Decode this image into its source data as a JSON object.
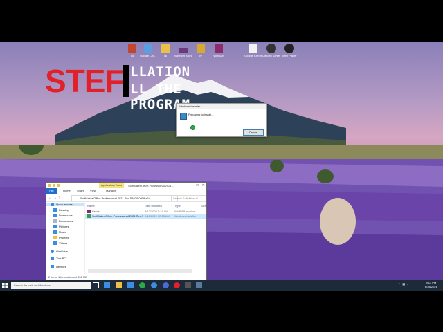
{
  "desktop_icons": [
    {
      "label": "y5",
      "color": "#c2452e"
    },
    {
      "label": "Google Chr...",
      "color": "#5aa0e0"
    },
    {
      "label": "y6",
      "color": "#e9c14a"
    },
    {
      "label": "WinRAR Archive",
      "color": "#6a3a7a"
    },
    {
      "label": "y7",
      "color": "#d9a830"
    },
    {
      "label": "WinRAR",
      "color": "#8c2a6a"
    },
    {
      "label": "Google Chrome",
      "color": "#f2f2f2"
    },
    {
      "label": "Discord Screen...",
      "color": "#333333"
    },
    {
      "label": "Vinyl Player",
      "color": "#222222"
    }
  ],
  "overlay": {
    "red_text": "STEF",
    "line1": "LLATION",
    "line2": "LL THE PROGRAM"
  },
  "installer": {
    "title": "Windows Installer",
    "message": "Preparing to install...",
    "cancel_label": "Cancel"
  },
  "explorer": {
    "app_tools": "Application Tools",
    "title": "SoftMaker.Office.Professional.2021...",
    "ribbon_tabs": [
      "File",
      "Home",
      "Share",
      "View",
      "Manage"
    ],
    "path": "SoftMaker.Office.Professional.2021.Rev.S1020.0909.x64",
    "search_placeholder": "Search SoftMaker.O...",
    "nav_items": [
      "Quick access",
      "Desktop",
      "Downloads",
      "Documents",
      "Pictures",
      "Music",
      "Projects",
      "Videos",
      "OneDrive",
      "This PC",
      "Network"
    ],
    "columns": [
      "Name",
      "Date modified",
      "Type",
      "Size"
    ],
    "rows": [
      {
        "name": "Crack",
        "date": "9/12/2020 5:34 AM",
        "type": "WinRAR archive",
        "size": ""
      },
      {
        "name": "SoftMaker.Office.Professional.2021.Rev.S...",
        "date": "9/12/2020 12:15 AM",
        "type": "Windows Installer",
        "size": ""
      }
    ],
    "status": "2 items    1 item selected  431 MB"
  },
  "taskbar": {
    "search_placeholder": "Search the web and Windows",
    "time": "9:13 PM",
    "date": "6/28/2021"
  }
}
